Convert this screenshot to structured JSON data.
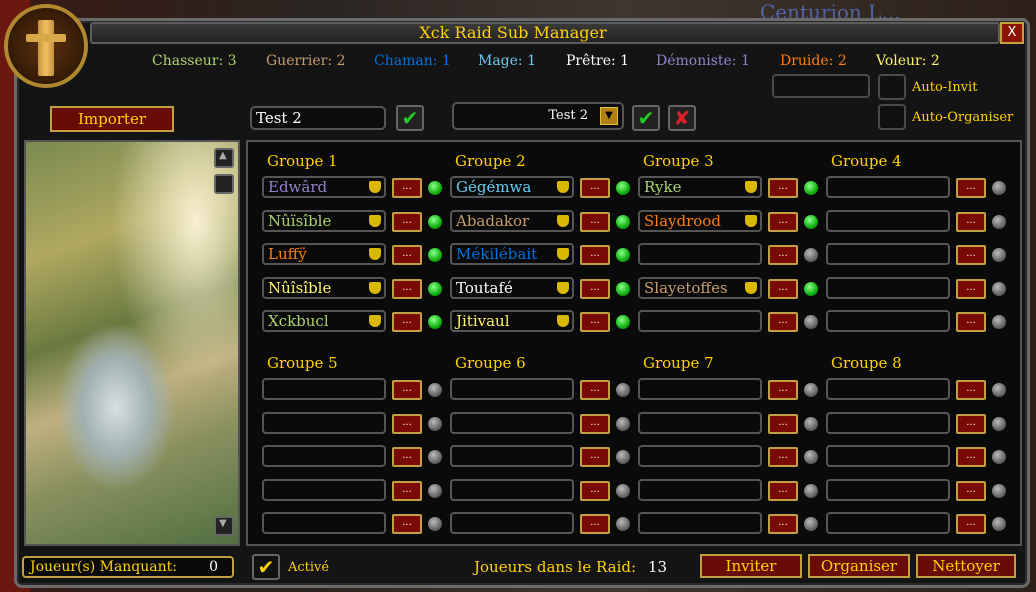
{
  "window": {
    "title": "Xck Raid Sub Manager",
    "close_label": "X",
    "background_text": "Centurion L..."
  },
  "class_counts": [
    {
      "label": "Chasseur: 3",
      "color": "#abd473"
    },
    {
      "label": "Guerrier: 2",
      "color": "#c79c6e"
    },
    {
      "label": "Chaman: 1",
      "color": "#0070de"
    },
    {
      "label": "Mage: 1",
      "color": "#69ccf0"
    },
    {
      "label": "Prêtre: 1",
      "color": "#ffffff"
    },
    {
      "label": "Démoniste: 1",
      "color": "#9482c9"
    },
    {
      "label": "Druide: 2",
      "color": "#ff7d0a"
    },
    {
      "label": "Voleur: 2",
      "color": "#fff569"
    }
  ],
  "toolbar": {
    "import_label": "Importer",
    "name_input_value": "Test 2",
    "template_dropdown_value": "Test 2",
    "auto_invite_label": "Auto-Invit",
    "auto_organize_label": "Auto-Organiser"
  },
  "groups": [
    {
      "title": "Groupe 1",
      "slots": [
        {
          "name": "Edwârd",
          "color": "#9482c9",
          "leader": true,
          "online": true
        },
        {
          "name": "Nûïsîble",
          "color": "#abd473",
          "leader": true,
          "online": true
        },
        {
          "name": "Luffÿ",
          "color": "#ff7d0a",
          "leader": true,
          "online": true
        },
        {
          "name": "Nûîsîble",
          "color": "#fff569",
          "leader": true,
          "online": true
        },
        {
          "name": "Xckbucl",
          "color": "#abd473",
          "leader": true,
          "online": true
        }
      ]
    },
    {
      "title": "Groupe 2",
      "slots": [
        {
          "name": "Gégémwa",
          "color": "#69ccf0",
          "leader": true,
          "online": true
        },
        {
          "name": "Abadakor",
          "color": "#c79c6e",
          "leader": true,
          "online": true
        },
        {
          "name": "Mékilébait",
          "color": "#0070de",
          "leader": true,
          "online": true
        },
        {
          "name": "Toutafé",
          "color": "#ffffff",
          "leader": true,
          "online": true
        },
        {
          "name": "Jitivaul",
          "color": "#fff569",
          "leader": true,
          "online": true
        }
      ]
    },
    {
      "title": "Groupe 3",
      "slots": [
        {
          "name": "Ryke",
          "color": "#abd473",
          "leader": true,
          "online": true
        },
        {
          "name": "Slaydrood",
          "color": "#ff7d0a",
          "leader": true,
          "online": true
        },
        {
          "name": "",
          "color": "#ffffff",
          "leader": false,
          "online": false
        },
        {
          "name": "Slayetoffes",
          "color": "#c79c6e",
          "leader": true,
          "online": true
        },
        {
          "name": "",
          "color": "#ffffff",
          "leader": false,
          "online": false
        }
      ]
    },
    {
      "title": "Groupe 4",
      "slots": [
        {
          "name": "",
          "color": "#ffffff",
          "leader": false,
          "online": false
        },
        {
          "name": "",
          "color": "#ffffff",
          "leader": false,
          "online": false
        },
        {
          "name": "",
          "color": "#ffffff",
          "leader": false,
          "online": false
        },
        {
          "name": "",
          "color": "#ffffff",
          "leader": false,
          "online": false
        },
        {
          "name": "",
          "color": "#ffffff",
          "leader": false,
          "online": false
        }
      ]
    },
    {
      "title": "Groupe 5",
      "slots": [
        {
          "name": "",
          "color": "#ffffff",
          "leader": false,
          "online": false
        },
        {
          "name": "",
          "color": "#ffffff",
          "leader": false,
          "online": false
        },
        {
          "name": "",
          "color": "#ffffff",
          "leader": false,
          "online": false
        },
        {
          "name": "",
          "color": "#ffffff",
          "leader": false,
          "online": false
        },
        {
          "name": "",
          "color": "#ffffff",
          "leader": false,
          "online": false
        }
      ]
    },
    {
      "title": "Groupe 6",
      "slots": [
        {
          "name": "",
          "color": "#ffffff",
          "leader": false,
          "online": false
        },
        {
          "name": "",
          "color": "#ffffff",
          "leader": false,
          "online": false
        },
        {
          "name": "",
          "color": "#ffffff",
          "leader": false,
          "online": false
        },
        {
          "name": "",
          "color": "#ffffff",
          "leader": false,
          "online": false
        },
        {
          "name": "",
          "color": "#ffffff",
          "leader": false,
          "online": false
        }
      ]
    },
    {
      "title": "Groupe 7",
      "slots": [
        {
          "name": "",
          "color": "#ffffff",
          "leader": false,
          "online": false
        },
        {
          "name": "",
          "color": "#ffffff",
          "leader": false,
          "online": false
        },
        {
          "name": "",
          "color": "#ffffff",
          "leader": false,
          "online": false
        },
        {
          "name": "",
          "color": "#ffffff",
          "leader": false,
          "online": false
        },
        {
          "name": "",
          "color": "#ffffff",
          "leader": false,
          "online": false
        }
      ]
    },
    {
      "title": "Groupe 8",
      "slots": [
        {
          "name": "",
          "color": "#ffffff",
          "leader": false,
          "online": false
        },
        {
          "name": "",
          "color": "#ffffff",
          "leader": false,
          "online": false
        },
        {
          "name": "",
          "color": "#ffffff",
          "leader": false,
          "online": false
        },
        {
          "name": "",
          "color": "#ffffff",
          "leader": false,
          "online": false
        },
        {
          "name": "",
          "color": "#ffffff",
          "leader": false,
          "online": false
        }
      ]
    }
  ],
  "slot_menu_label": "...",
  "footer": {
    "missing_label": "Joueur(s) Manquant:",
    "missing_value": "0",
    "active_label": "Activé",
    "raid_count_label": "Joueurs dans le Raid:",
    "raid_count_value": "13",
    "invite_label": "Inviter",
    "organize_label": "Organiser",
    "clean_label": "Nettoyer"
  },
  "icons": {
    "confirm": "✔",
    "cancel": "✘",
    "active_check": "✔",
    "dropdown": "▼"
  },
  "colors": {
    "accent_gold": "#ffd200",
    "button_red": "#6a0c06",
    "online_green": "#10b010"
  }
}
